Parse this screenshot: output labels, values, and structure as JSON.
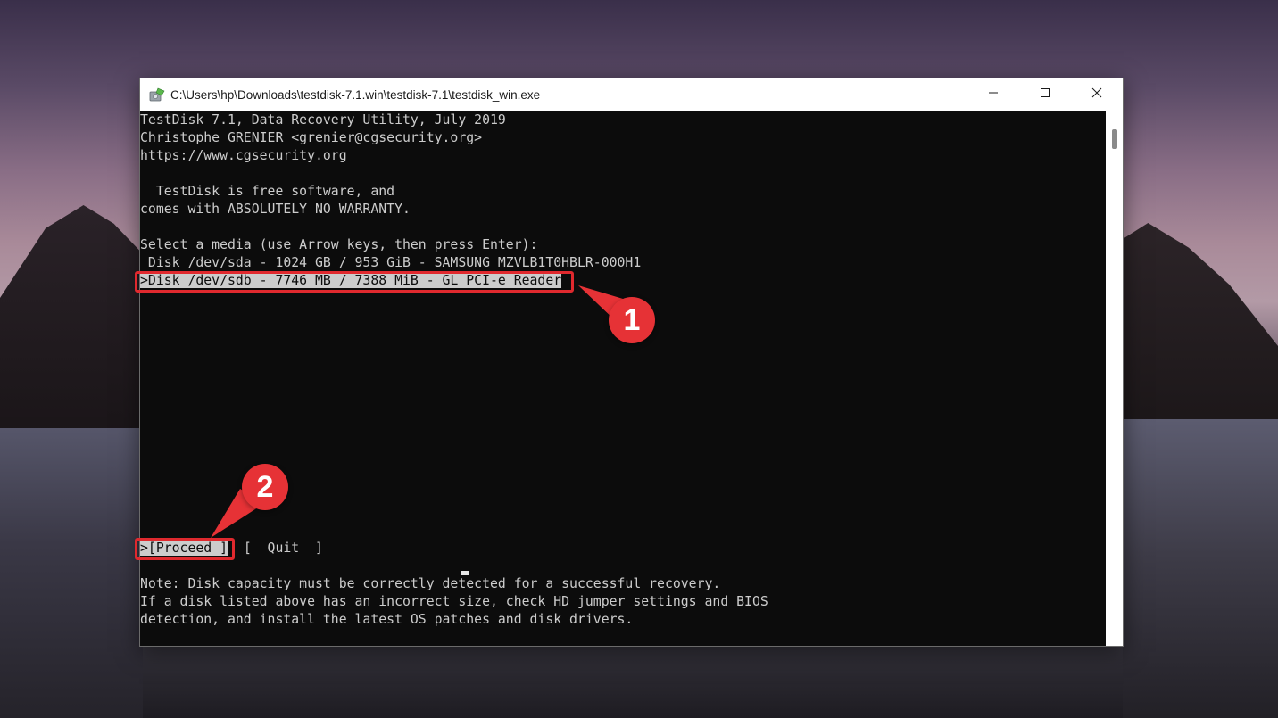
{
  "window": {
    "title": "C:\\Users\\hp\\Downloads\\testdisk-7.1.win\\testdisk-7.1\\testdisk_win.exe",
    "icon": "testdisk-app-icon",
    "controls": [
      "minimize-icon",
      "maximize-icon",
      "close-icon"
    ]
  },
  "console": {
    "header": [
      "TestDisk 7.1, Data Recovery Utility, July 2019",
      "Christophe GRENIER <grenier@cgsecurity.org>",
      "https://www.cgsecurity.org"
    ],
    "license": [
      "  TestDisk is free software, and",
      "comes with ABSOLUTELY NO WARRANTY."
    ],
    "prompt": "Select a media (use Arrow keys, then press Enter):",
    "disks": [
      {
        "text": " Disk /dev/sda - 1024 GB / 953 GiB - SAMSUNG MZVLB1T0HBLR-000H1",
        "selected": false
      },
      {
        "text": ">Disk /dev/sdb - 7746 MB / 7388 MiB - GL PCI-e Reader",
        "selected": true
      }
    ],
    "menu": {
      "proceed": ">[Proceed ]",
      "quit": "[  Quit  ]"
    },
    "notes": [
      "Note: Disk capacity must be correctly detected for a successful recovery.",
      "If a disk listed above has an incorrect size, check HD jumper settings and BIOS",
      "detection, and install the latest OS patches and disk drivers."
    ]
  },
  "annotations": {
    "step1": "1",
    "step2": "2",
    "color": "#e63236"
  }
}
